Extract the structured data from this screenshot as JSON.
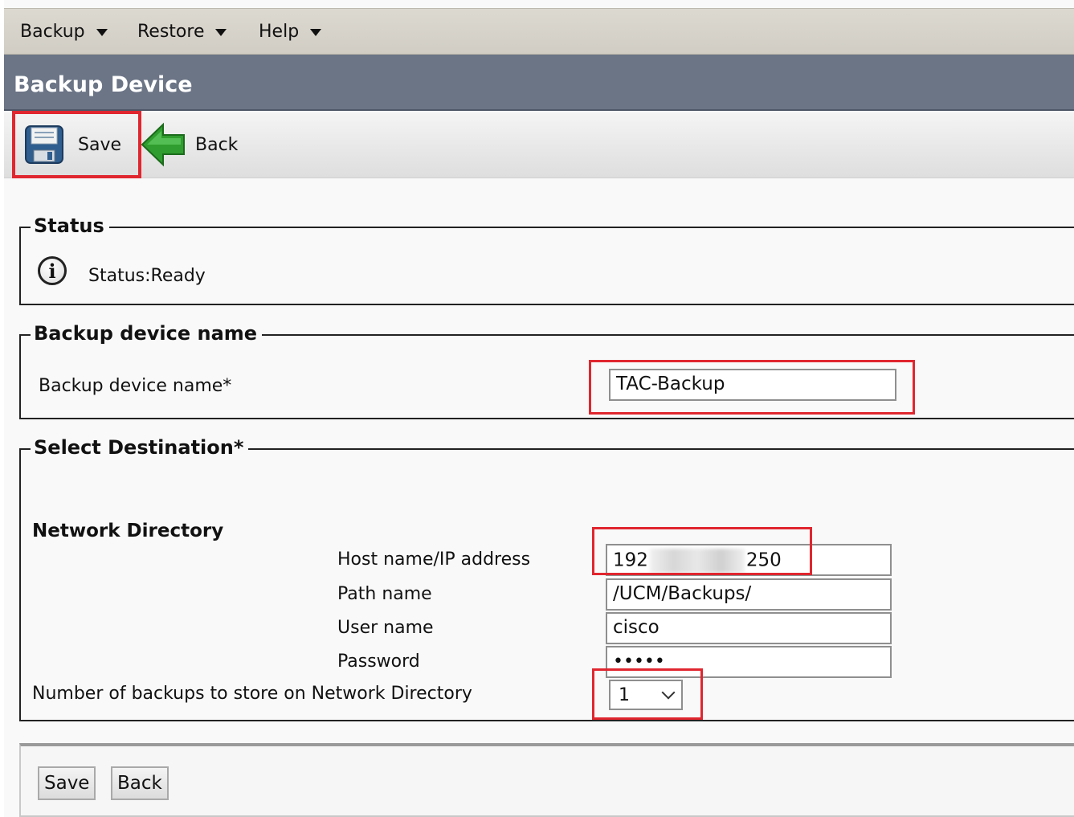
{
  "menu": {
    "backup": "Backup",
    "restore": "Restore",
    "help": "Help"
  },
  "page_title": "Backup Device",
  "toolbar": {
    "save_label": "Save",
    "back_label": "Back"
  },
  "status_section": {
    "legend": "Status",
    "text": "Status:Ready"
  },
  "device_section": {
    "legend": "Backup device name",
    "label": "Backup device name*",
    "value": "TAC-Backup"
  },
  "destination_section": {
    "legend": "Select Destination*",
    "subheading": "Network Directory",
    "host_label": "Host name/IP address",
    "host_value_start": "192",
    "host_value_end": "250",
    "path_label": "Path name",
    "path_value": "/UCM/Backups/",
    "user_label": "User name",
    "user_value": "cisco",
    "password_label": "Password",
    "password_value": "•••••",
    "backups_label": "Number of backups to store on Network Directory",
    "backups_value": "1"
  },
  "bottom_buttons": {
    "save_label": "Save",
    "back_label": "Back"
  },
  "colors": {
    "title_bar": "#6b7586",
    "highlight": "#e0262f",
    "back_arrow": "#2f9d2f"
  }
}
